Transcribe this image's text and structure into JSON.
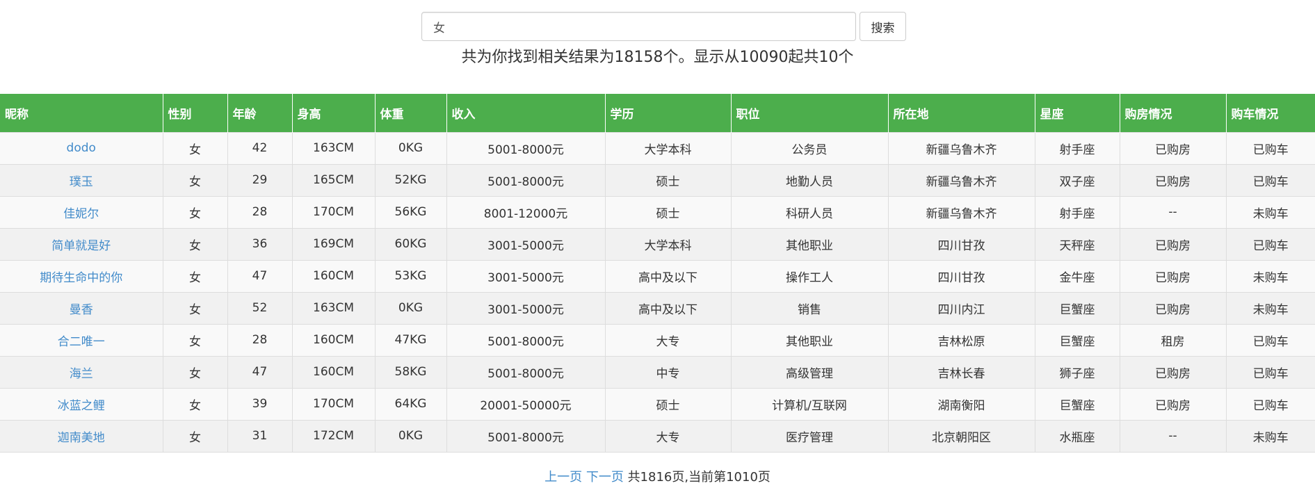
{
  "search": {
    "value": "女",
    "placeholder": "",
    "button_label": "搜索"
  },
  "summary": "共为你找到相关结果为18158个。显示从10090起共10个",
  "table": {
    "columns": [
      "昵称",
      "性别",
      "年龄",
      "身高",
      "体重",
      "收入",
      "学历",
      "职位",
      "所在地",
      "星座",
      "购房情况",
      "购车情况"
    ],
    "rows": [
      [
        "dodo",
        "女",
        "42",
        "163CM",
        "0KG",
        "5001-8000元",
        "大学本科",
        "公务员",
        "新疆乌鲁木齐",
        "射手座",
        "已购房",
        "已购车"
      ],
      [
        "璞玉",
        "女",
        "29",
        "165CM",
        "52KG",
        "5001-8000元",
        "硕士",
        "地勤人员",
        "新疆乌鲁木齐",
        "双子座",
        "已购房",
        "已购车"
      ],
      [
        "佳妮尔",
        "女",
        "28",
        "170CM",
        "56KG",
        "8001-12000元",
        "硕士",
        "科研人员",
        "新疆乌鲁木齐",
        "射手座",
        "--",
        "未购车"
      ],
      [
        "简单就是好",
        "女",
        "36",
        "169CM",
        "60KG",
        "3001-5000元",
        "大学本科",
        "其他职业",
        "四川甘孜",
        "天秤座",
        "已购房",
        "已购车"
      ],
      [
        "期待生命中的你",
        "女",
        "47",
        "160CM",
        "53KG",
        "3001-5000元",
        "高中及以下",
        "操作工人",
        "四川甘孜",
        "金牛座",
        "已购房",
        "未购车"
      ],
      [
        "曼香",
        "女",
        "52",
        "163CM",
        "0KG",
        "3001-5000元",
        "高中及以下",
        "销售",
        "四川内江",
        "巨蟹座",
        "已购房",
        "未购车"
      ],
      [
        "合二唯一",
        "女",
        "28",
        "160CM",
        "47KG",
        "5001-8000元",
        "大专",
        "其他职业",
        "吉林松原",
        "巨蟹座",
        "租房",
        "已购车"
      ],
      [
        "海兰",
        "女",
        "47",
        "160CM",
        "58KG",
        "5001-8000元",
        "中专",
        "高级管理",
        "吉林长春",
        "狮子座",
        "已购房",
        "已购车"
      ],
      [
        "冰蓝之鲤",
        "女",
        "39",
        "170CM",
        "64KG",
        "20001-50000元",
        "硕士",
        "计算机/互联网",
        "湖南衡阳",
        "巨蟹座",
        "已购房",
        "已购车"
      ],
      [
        "迦南美地",
        "女",
        "31",
        "172CM",
        "0KG",
        "5001-8000元",
        "大专",
        "医疗管理",
        "北京朝阳区",
        "水瓶座",
        "--",
        "未购车"
      ]
    ]
  },
  "pager": {
    "prev_label": "上一页",
    "next_label": "下一页",
    "info": "共1816页,当前第1010页"
  },
  "colors": {
    "header_bg": "#4cae4c",
    "link": "#428bca",
    "row_odd": "#f9f9f9",
    "row_even": "#f1f1f1"
  }
}
